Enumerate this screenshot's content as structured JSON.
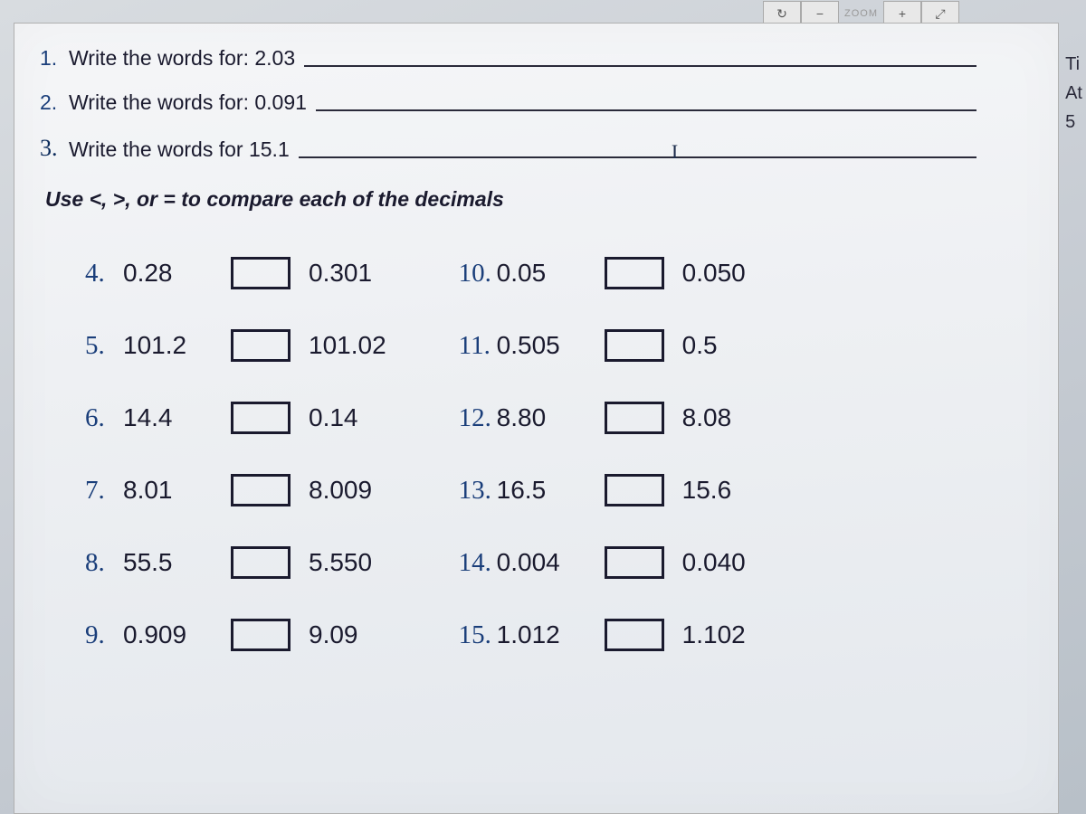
{
  "toolbar": {
    "refresh_icon": "↻",
    "zoom_label": "ZOOM",
    "minus": "−",
    "plus": "+",
    "expand": "⤢"
  },
  "side": [
    "Ti",
    "At",
    "5"
  ],
  "intro": [
    {
      "num": "1.",
      "text": "Write the words for: 2.03",
      "cursor": ""
    },
    {
      "num": "2.",
      "text": "Write the words for: 0.091",
      "cursor": ""
    },
    {
      "num": "3.",
      "text": "Write the words for 15.1",
      "cursor": "I",
      "hand": true
    }
  ],
  "instruction": "Use <, >, or = to compare each of the decimals",
  "compare_left": [
    {
      "num": "4.",
      "a": "0.28",
      "b": "0.301"
    },
    {
      "num": "5.",
      "a": "101.2",
      "b": "101.02"
    },
    {
      "num": "6.",
      "a": "14.4",
      "b": "0.14"
    },
    {
      "num": "7.",
      "a": "8.01",
      "b": "8.009"
    },
    {
      "num": "8.",
      "a": "55.5",
      "b": "5.550"
    },
    {
      "num": "9.",
      "a": "0.909",
      "b": "9.09"
    }
  ],
  "compare_right": [
    {
      "num": "10.",
      "a": "0.05",
      "b": "0.050"
    },
    {
      "num": "11.",
      "a": "0.505",
      "b": "0.5"
    },
    {
      "num": "12.",
      "a": "8.80",
      "b": "8.08"
    },
    {
      "num": "13.",
      "a": "16.5",
      "b": "15.6"
    },
    {
      "num": "14.",
      "a": "0.004",
      "b": "0.040"
    },
    {
      "num": "15.",
      "a": "1.012",
      "b": "1.102"
    }
  ]
}
